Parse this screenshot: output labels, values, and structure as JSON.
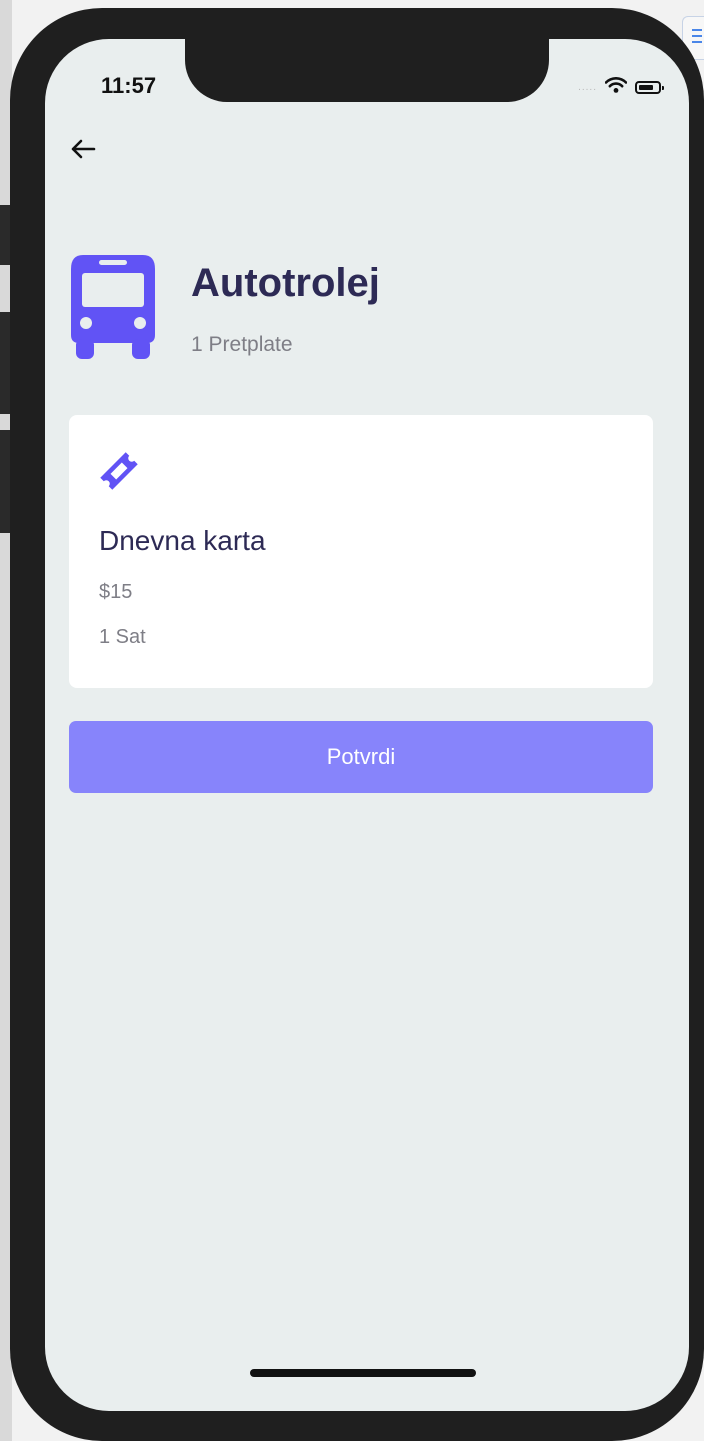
{
  "status_bar": {
    "time": "11:57",
    "signal": "....."
  },
  "nav": {
    "back_icon": "arrow-left-icon"
  },
  "header": {
    "icon": "bus-icon",
    "title": "Autotrolej",
    "subtitle": "1 Pretplate"
  },
  "ticket": {
    "icon": "ticket-icon",
    "name": "Dnevna karta",
    "price": "$15",
    "duration": "1 Sat"
  },
  "actions": {
    "confirm_label": "Potvrdi"
  },
  "colors": {
    "accent": "#6153f5",
    "button": "#8784fb",
    "title": "#2d2a55",
    "muted": "#7e7e86",
    "background": "#e9eeee",
    "card": "#ffffff"
  }
}
